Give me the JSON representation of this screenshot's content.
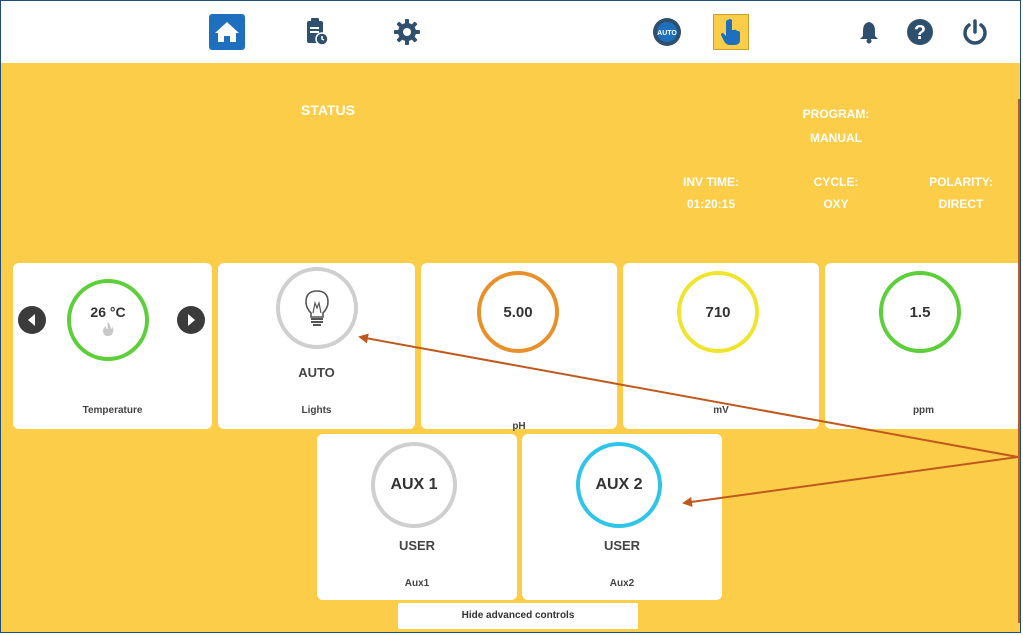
{
  "toolbar": {
    "items": [
      {
        "name": "home",
        "icon": "home-icon",
        "active": true
      },
      {
        "name": "report",
        "icon": "clipboard-clock-icon"
      },
      {
        "name": "settings",
        "icon": "gear-icon"
      },
      {
        "name": "auto-mode",
        "icon": "auto-badge-icon",
        "label": "AUTO"
      },
      {
        "name": "manual-mode",
        "icon": "hand-pointer-icon",
        "active": true
      },
      {
        "name": "notifications",
        "icon": "bell-icon"
      },
      {
        "name": "help",
        "icon": "help-icon",
        "label": "?"
      },
      {
        "name": "power",
        "icon": "power-icon"
      }
    ]
  },
  "status": {
    "title": "STATUS",
    "program_label": "PROGRAM:",
    "program_value": "MANUAL",
    "inv_time_label": "INV TIME:",
    "inv_time_value": "01:20:15",
    "cycle_label": "CYCLE:",
    "cycle_value": "OXY",
    "polarity_label": "POLARITY:",
    "polarity_value": "DIRECT"
  },
  "cards": {
    "temperature": {
      "value": "26 °C",
      "label": "Temperature",
      "ring_color": "#5ccf3a"
    },
    "lights": {
      "mode": "AUTO",
      "label": "Lights",
      "ring_color": "#cfcfcf"
    },
    "ph": {
      "value": "5.00",
      "label": "pH",
      "ring_color": "#e8912a"
    },
    "mv": {
      "value": "710",
      "label": "mV",
      "ring_color": "#efe52e"
    },
    "ppm": {
      "value": "1.5",
      "label": "ppm",
      "ring_color": "#5ccf3a"
    },
    "aux1": {
      "value": "AUX 1",
      "mode": "USER",
      "label": "Aux1",
      "ring_color": "#cfcfcf"
    },
    "aux2": {
      "value": "AUX 2",
      "mode": "USER",
      "label": "Aux2",
      "ring_color": "#2ec5e8"
    }
  },
  "hide_controls_label": "Hide advanced controls",
  "colors": {
    "background": "#fbcd48",
    "home_button": "#1f6fbf",
    "annotation": "#c0591e"
  }
}
